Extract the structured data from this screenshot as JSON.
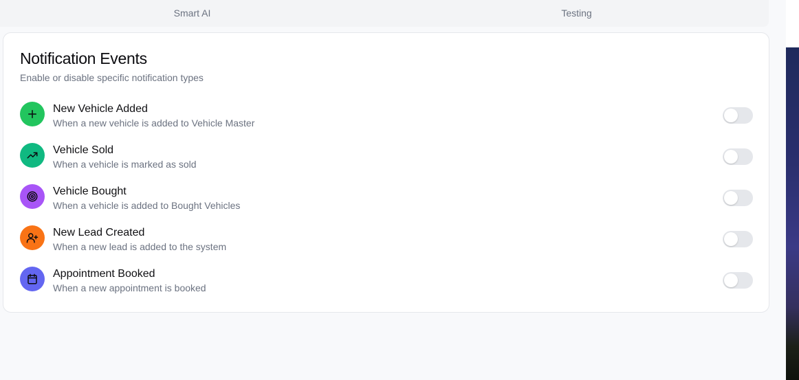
{
  "tabs": [
    {
      "label": "Smart AI"
    },
    {
      "label": "Testing"
    }
  ],
  "card": {
    "title": "Notification Events",
    "subtitle": "Enable or disable specific notification types"
  },
  "events": [
    {
      "title": "New Vehicle Added",
      "description": "When a new vehicle is added to Vehicle Master",
      "icon": "plus-icon",
      "color": "#22c55e",
      "enabled": false
    },
    {
      "title": "Vehicle Sold",
      "description": "When a vehicle is marked as sold",
      "icon": "trending-up-icon",
      "color": "#10b981",
      "enabled": false
    },
    {
      "title": "Vehicle Bought",
      "description": "When a vehicle is added to Bought Vehicles",
      "icon": "target-icon",
      "color": "#a855f7",
      "enabled": false
    },
    {
      "title": "New Lead Created",
      "description": "When a new lead is added to the system",
      "icon": "user-plus-icon",
      "color": "#f97316",
      "enabled": false
    },
    {
      "title": "Appointment Booked",
      "description": "When a new appointment is booked",
      "icon": "calendar-icon",
      "color": "#6366f1",
      "enabled": false
    }
  ],
  "colors": {
    "page_bg": "#f8f9fb",
    "toggle_off": "#e5e7eb"
  }
}
